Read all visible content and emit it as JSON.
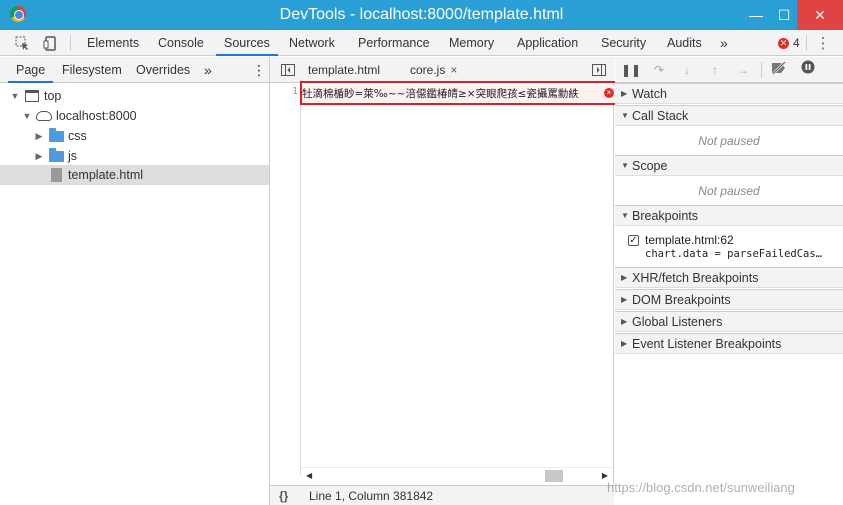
{
  "window": {
    "title": "DevTools - localhost:8000/template.html",
    "minimize_glyph": "—",
    "maximize_glyph": "☐",
    "close_glyph": "✕"
  },
  "main_toolbar": {
    "tabs": [
      "Elements",
      "Console",
      "Sources",
      "Network",
      "Performance",
      "Memory",
      "Application",
      "Security",
      "Audits"
    ],
    "active_tab": "Sources",
    "more_glyph": "»",
    "error_count": "4",
    "error_glyph": "✕",
    "menu_glyph": "⋮"
  },
  "navigator": {
    "tabs": [
      "Page",
      "Filesystem",
      "Overrides"
    ],
    "active_tab": "Page",
    "more_glyph": "»",
    "menu_glyph": "⋮",
    "tree": [
      {
        "label": "top"
      },
      {
        "label": "localhost:8000"
      },
      {
        "label": "css"
      },
      {
        "label": "js"
      },
      {
        "label": "template.html",
        "selected": true
      }
    ]
  },
  "editor": {
    "tabs": [
      {
        "label": "template.html"
      },
      {
        "label": "core.js",
        "close": "×",
        "active": true
      }
    ],
    "line_number": "1",
    "code_text": "牡滴棉楯眇=萊‰~~涪僫鑑椿皘≥×突眼爬孩≤瓷攝罵勳紩",
    "status_position": "Line 1, Column 381842",
    "pretty_print_glyph": "{}"
  },
  "debugger": {
    "sections": {
      "watch": "Watch",
      "call_stack": "Call Stack",
      "scope": "Scope",
      "breakpoints": "Breakpoints",
      "xhr": "XHR/fetch Breakpoints",
      "dom": "DOM Breakpoints",
      "global": "Global Listeners",
      "event": "Event Listener Breakpoints"
    },
    "not_paused": "Not paused",
    "breakpoint": {
      "file": "template.html:62",
      "code": "chart.data = parseFailedCas…",
      "checked": true,
      "check_glyph": "✓"
    }
  },
  "watermark": "https://blog.csdn.net/sunweiliang"
}
